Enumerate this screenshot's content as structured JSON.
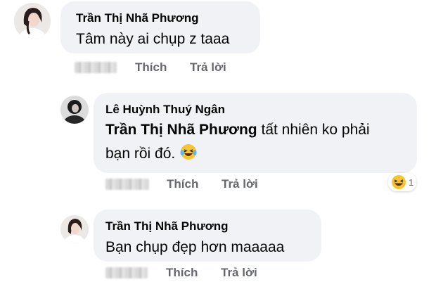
{
  "comments": [
    {
      "author": "Trần Thị Nhã Phương",
      "text": "Tâm này ai chụp z taaa",
      "like_label": "Thích",
      "reply_label": "Trả lời"
    },
    {
      "author": "Lê Huỳnh Thuý Ngân",
      "mention": "Trần Thị Nhã Phương",
      "text_line1": "tất nhiên ko phải",
      "text_line2": "bạn rồi đó.",
      "like_label": "Thích",
      "reply_label": "Trả lời",
      "reaction_count": "1"
    },
    {
      "author": "Trần Thị Nhã Phương",
      "text": "Bạn chụp đẹp hơn maaaaa",
      "like_label": "Thích",
      "reply_label": "Trả lời"
    }
  ],
  "icons": {
    "laughing_emoji": "laughing-emoji-icon",
    "haha_reaction": "haha-reaction-icon"
  },
  "colors": {
    "bubble": "#f0f2f5",
    "text": "#050505",
    "secondary": "#65676b"
  }
}
